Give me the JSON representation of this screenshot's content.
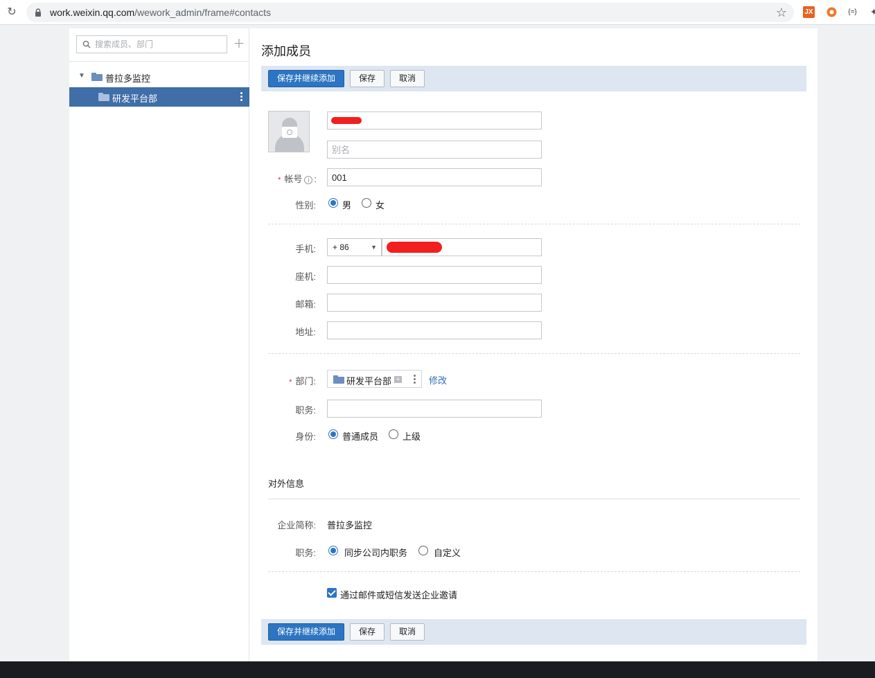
{
  "browser": {
    "url_host": "work.weixin.qq.com",
    "url_path": "/wework_admin/frame#contacts",
    "ext_jx": "JX",
    "ext_json": "{=}"
  },
  "sidebar": {
    "search_placeholder": "搜索成员、部门",
    "add_symbol": "+",
    "tree_root": "普拉多监控",
    "tree_child": "研发平台部"
  },
  "page": {
    "title": "添加成员"
  },
  "toolbar": {
    "save_continue": "保存并继续添加",
    "save": "保存",
    "cancel": "取消"
  },
  "form": {
    "alias_placeholder": "别名",
    "account_label": "帐号",
    "account_info": "i",
    "account_value": "001",
    "gender_label": "性别:",
    "gender_male": "男",
    "gender_female": "女",
    "gender_selected": "男",
    "phone_label": "手机:",
    "phone_country": "+ 86",
    "landline_label": "座机:",
    "email_label": "邮箱:",
    "address_label": "地址:",
    "dept_label": "部门:",
    "dept_name": "研发平台部",
    "dept_badge": "≡",
    "dept_modify": "修改",
    "position_label": "职务:",
    "identity_label": "身份:",
    "identity_regular": "普通成员",
    "identity_superior": "上级",
    "identity_selected": "普通成员"
  },
  "external": {
    "section_title": "对外信息",
    "company_label": "企业简称:",
    "company_value": "普拉多监控",
    "position_label": "职务:",
    "position_sync": "同步公司内职务",
    "position_custom": "自定义",
    "position_selected": "同步公司内职务",
    "invite_label": "通过邮件或短信发送企业邀请",
    "invite_checked": true
  },
  "colors": {
    "primary": "#2d75c2",
    "toolbar_bg": "#dde6f1",
    "sidebar_selected": "#3f6ea8",
    "required": "#d42f2f",
    "link": "#2d6fb8"
  }
}
